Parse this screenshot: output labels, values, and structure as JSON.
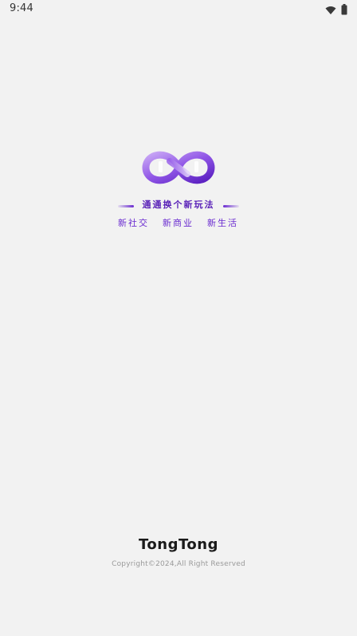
{
  "status_bar": {
    "time": "9:44",
    "icons": [
      "wifi-icon",
      "battery-icon"
    ]
  },
  "splash": {
    "logo": "infinity-logo",
    "tagline": "通通换个新玩法",
    "slogans": [
      "新社交",
      "新商业",
      "新生活"
    ]
  },
  "footer": {
    "brand": "TongTong",
    "copyright": "Copyright©2024,All Right Reserved"
  },
  "colors": {
    "background": "#f2f2f2",
    "accent": "#6a2bd0",
    "accent_light": "#b58cf0"
  }
}
